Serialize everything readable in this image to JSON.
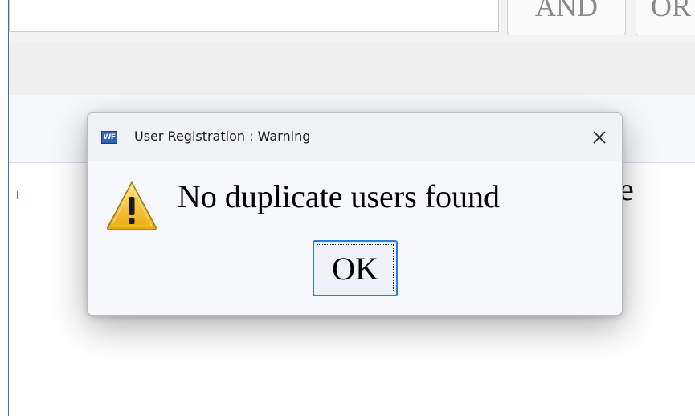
{
  "background": {
    "op_and_label": "AND",
    "op_or_label": "OR",
    "obscured_text_fragment": "e"
  },
  "dialog": {
    "title": "User Registration : Warning",
    "app_icon_text": "WF",
    "message": "No duplicate users found",
    "ok_label": "OK",
    "close_glyph": "✕",
    "icon": "warning-icon"
  },
  "colors": {
    "accent": "#2e7bd6",
    "warning_yellow": "#f5c21b",
    "dialog_bg": "#f7f8fb",
    "window_border": "#4a6da8"
  }
}
